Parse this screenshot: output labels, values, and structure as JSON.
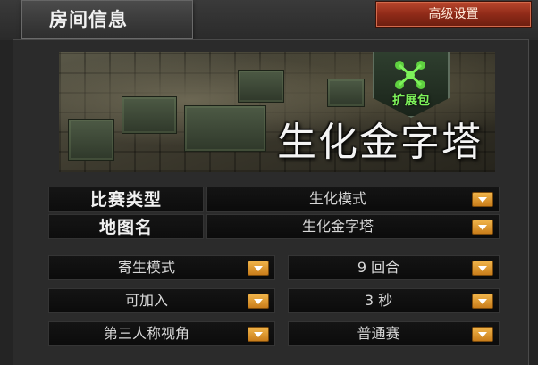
{
  "header": {
    "title": "房间信息",
    "advanced_button": "高级设置"
  },
  "banner": {
    "badge_label": "扩展包",
    "map_title": "生化金字塔",
    "badge_icon": "biohazard-icon"
  },
  "info": {
    "match_type": {
      "label": "比赛类型",
      "value": "生化模式"
    },
    "map_name": {
      "label": "地图名",
      "value": "生化金字塔"
    }
  },
  "options": {
    "mode": "寄生模式",
    "rounds": "9 回合",
    "join": "可加入",
    "time": "3 秒",
    "view": "第三人称视角",
    "match": "普通赛"
  },
  "colors": {
    "accent_button": "#8f2a18",
    "dropdown_arrow": "#e09a2c",
    "badge_green": "#7df25a"
  }
}
